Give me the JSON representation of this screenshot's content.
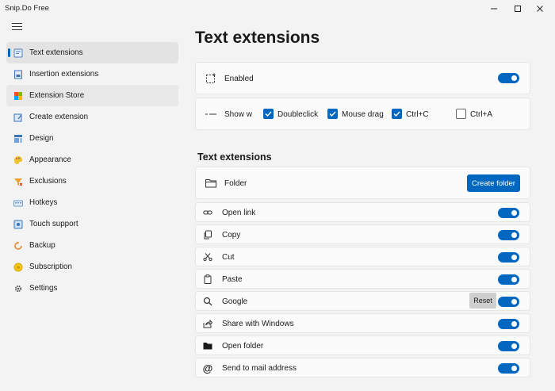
{
  "window": {
    "title": "Snip.Do Free",
    "minimize": "─",
    "maximize": "☐",
    "close": "✕"
  },
  "nav": {
    "items": [
      {
        "label": "Text extensions",
        "icon": "text-extensions-icon"
      },
      {
        "label": "Insertion extensions",
        "icon": "insertion-icon"
      },
      {
        "label": "Extension Store",
        "icon": "store-icon"
      },
      {
        "label": "Create extension",
        "icon": "create-icon"
      },
      {
        "label": "Design",
        "icon": "design-icon"
      },
      {
        "label": "Appearance",
        "icon": "appearance-icon"
      },
      {
        "label": "Exclusions",
        "icon": "exclusions-icon"
      },
      {
        "label": "Hotkeys",
        "icon": "hotkeys-icon"
      },
      {
        "label": "Touch support",
        "icon": "touch-icon"
      },
      {
        "label": "Backup",
        "icon": "backup-icon"
      },
      {
        "label": "Subscription",
        "icon": "subscription-icon"
      },
      {
        "label": "Settings",
        "icon": "gear-icon"
      }
    ],
    "selected": "Text extensions",
    "hovered": "Extension Store"
  },
  "main": {
    "title": "Text extensions",
    "enabled": {
      "label": "Enabled",
      "on": true
    },
    "show_when": {
      "label": "Show w",
      "options": [
        {
          "label": "Doubleclick",
          "checked": true
        },
        {
          "label": "Mouse drag",
          "checked": true
        },
        {
          "label": "Ctrl+C",
          "checked": true
        },
        {
          "label": "Ctrl+A",
          "checked": false
        }
      ]
    },
    "section_title": "Text extensions",
    "folder": {
      "label": "Folder",
      "button": "Create folder"
    },
    "extensions": [
      {
        "label": "Open link",
        "icon": "link-icon",
        "on": true
      },
      {
        "label": "Copy",
        "icon": "copy-icon",
        "on": true
      },
      {
        "label": "Cut",
        "icon": "scissors-icon",
        "on": true
      },
      {
        "label": "Paste",
        "icon": "clipboard-icon",
        "on": true
      },
      {
        "label": "Google",
        "icon": "search-icon",
        "on": true,
        "reset": "Reset"
      },
      {
        "label": "Share with Windows",
        "icon": "share-icon",
        "on": true
      },
      {
        "label": "Open folder",
        "icon": "folder-filled-icon",
        "on": true
      },
      {
        "label": "Send to mail address",
        "icon": "at-icon",
        "on": true
      }
    ]
  },
  "colors": {
    "accent": "#0067c0",
    "background": "#f3f3f3",
    "card": "#fbfbfb"
  }
}
